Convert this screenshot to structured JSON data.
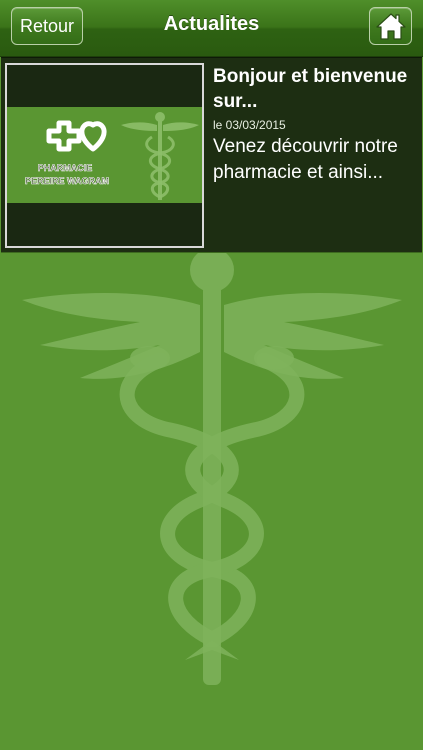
{
  "header": {
    "back_label": "Retour",
    "title": "Actualites",
    "home_icon": "home-icon"
  },
  "news": [
    {
      "title": "Bonjour et bienvenue sur...",
      "date": "le 03/03/2015",
      "excerpt": "Venez découvrir notre pharmacie et ainsi...",
      "thumbnail": {
        "logo_line1": "PHARMACIE",
        "logo_line2": "PEREIRE WAGRAM",
        "icon": "pharmacy-logo-icon"
      }
    }
  ],
  "colors": {
    "background": "#5a9632",
    "navbar": "#3b7419",
    "list_item_bg": "#1d2e12",
    "logo_green": "#5a9632"
  }
}
